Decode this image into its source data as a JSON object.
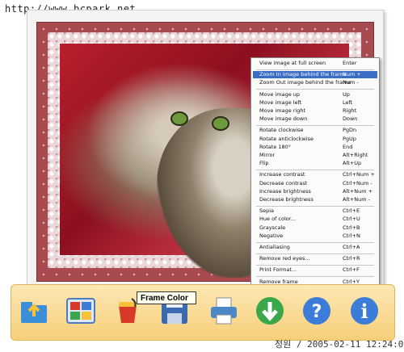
{
  "watermark_top": "http://www.bcpark.net",
  "watermark_bottom": "정원 / 2005-02-11 12:24:01",
  "menu": {
    "groups": [
      [
        {
          "label": "View image at full screen",
          "shortcut": "Enter"
        }
      ],
      [
        {
          "label": "Zoom In image behind the frame",
          "shortcut": "Num +",
          "highlighted": true
        },
        {
          "label": "Zoom Out image behind the frame",
          "shortcut": "Num -"
        }
      ],
      [
        {
          "label": "Move image up",
          "shortcut": "Up"
        },
        {
          "label": "Move image left",
          "shortcut": "Left"
        },
        {
          "label": "Move image right",
          "shortcut": "Right"
        },
        {
          "label": "Move image down",
          "shortcut": "Down"
        }
      ],
      [
        {
          "label": "Rotate clockwise",
          "shortcut": "PgDn"
        },
        {
          "label": "Rotate anticlockwise",
          "shortcut": "PgUp"
        },
        {
          "label": "Rotate 180°",
          "shortcut": "End"
        },
        {
          "label": "Mirror",
          "shortcut": "Alt+Right"
        },
        {
          "label": "Flip",
          "shortcut": "Alt+Up"
        }
      ],
      [
        {
          "label": "Increase contrast",
          "shortcut": "Ctrl+Num +"
        },
        {
          "label": "Decrease contrast",
          "shortcut": "Ctrl+Num -"
        },
        {
          "label": "Increase brightness",
          "shortcut": "Alt+Num +"
        },
        {
          "label": "Decrease brightness",
          "shortcut": "Alt+Num -"
        }
      ],
      [
        {
          "label": "Sepia",
          "shortcut": "Ctrl+E"
        },
        {
          "label": "Hue of color...",
          "shortcut": "Ctrl+U"
        },
        {
          "label": "Grayscale",
          "shortcut": "Ctrl+B"
        },
        {
          "label": "Negative",
          "shortcut": "Ctrl+N"
        }
      ],
      [
        {
          "label": "Antialiasing",
          "shortcut": "Ctrl+A"
        }
      ],
      [
        {
          "label": "Remove red eyes...",
          "shortcut": "Ctrl+R"
        }
      ],
      [
        {
          "label": "Print Format...",
          "shortcut": "Ctrl+F"
        }
      ],
      [
        {
          "label": "Remove frame",
          "shortcut": "Ctrl+Y"
        }
      ]
    ]
  },
  "tooltip": "Frame Color",
  "toolbar": {
    "buttons": [
      {
        "name": "open-folder-icon",
        "color": "#3a8fd8"
      },
      {
        "name": "frames-grid-icon",
        "color": "#4a7cc0"
      },
      {
        "name": "paint-bucket-icon",
        "color": "#d83a2a"
      },
      {
        "name": "save-disk-icon",
        "color": "#3a6ab0"
      },
      {
        "name": "printer-icon",
        "color": "#4a88c8"
      },
      {
        "name": "download-arrow-icon",
        "color": "#3aa84a"
      },
      {
        "name": "help-icon",
        "color": "#3a7cd8"
      },
      {
        "name": "info-icon",
        "color": "#3a7cd8"
      }
    ]
  },
  "colors": {
    "frame": "#a84a50",
    "menu_highlight": "#3a6cc8",
    "toolbar_bg": "#f7cf7a"
  }
}
